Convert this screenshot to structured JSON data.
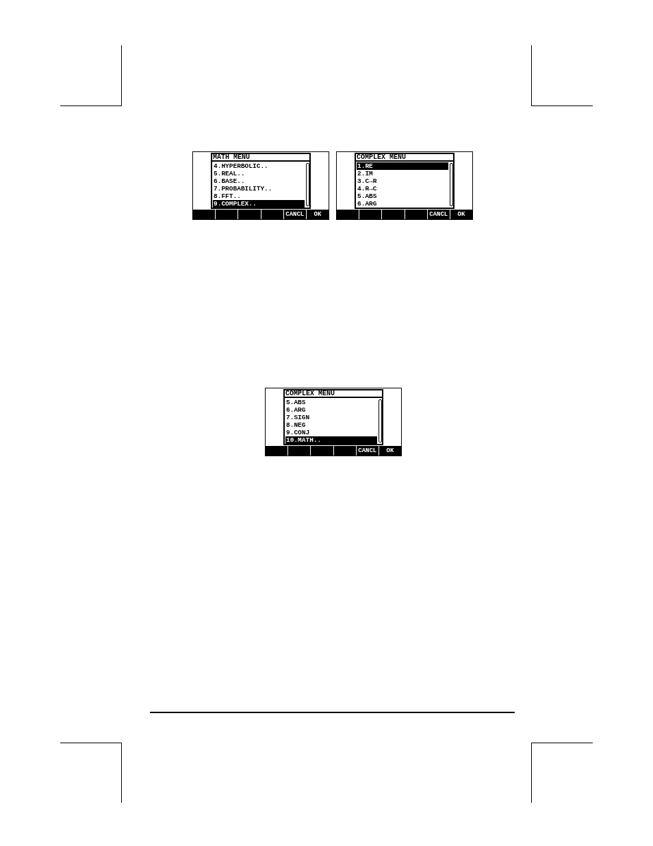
{
  "screens": [
    {
      "title": "MATH MENU",
      "items": [
        {
          "label": "4.HYPERBOLIC..",
          "selected": false
        },
        {
          "label": "5.REAL..",
          "selected": false
        },
        {
          "label": "6.BASE..",
          "selected": false
        },
        {
          "label": "7.PROBABILITY..",
          "selected": false
        },
        {
          "label": "8.FFT..",
          "selected": false
        },
        {
          "label": "9.COMPLEX..",
          "selected": true
        }
      ],
      "softkeys": [
        {
          "kind": "blank"
        },
        {
          "kind": "blank"
        },
        {
          "kind": "blank"
        },
        {
          "kind": "blank"
        },
        {
          "kind": "label",
          "label": "CANCL"
        },
        {
          "kind": "label",
          "label": "OK"
        }
      ]
    },
    {
      "title": "COMPLEX MENU",
      "items": [
        {
          "label": "1.RE",
          "selected": true
        },
        {
          "label": "2.IM",
          "selected": false
        },
        {
          "label": "3.C→R",
          "selected": false
        },
        {
          "label": "4.R→C",
          "selected": false
        },
        {
          "label": "5.ABS",
          "selected": false
        },
        {
          "label": "6.ARG",
          "selected": false
        }
      ],
      "softkeys": [
        {
          "kind": "blank"
        },
        {
          "kind": "blank"
        },
        {
          "kind": "blank"
        },
        {
          "kind": "blank"
        },
        {
          "kind": "label",
          "label": "CANCL"
        },
        {
          "kind": "label",
          "label": "OK"
        }
      ]
    },
    {
      "title": "COMPLEX MENU",
      "items": [
        {
          "label": "5.ABS",
          "selected": false
        },
        {
          "label": "6.ARG",
          "selected": false
        },
        {
          "label": "7.SIGN",
          "selected": false
        },
        {
          "label": "8.NEG",
          "selected": false
        },
        {
          "label": "9.CONJ",
          "selected": false
        },
        {
          "label": "10.MATH..",
          "selected": true
        }
      ],
      "softkeys": [
        {
          "kind": "blank"
        },
        {
          "kind": "blank"
        },
        {
          "kind": "blank"
        },
        {
          "kind": "blank"
        },
        {
          "kind": "label",
          "label": "CANCL"
        },
        {
          "kind": "label",
          "label": "OK"
        }
      ]
    }
  ]
}
